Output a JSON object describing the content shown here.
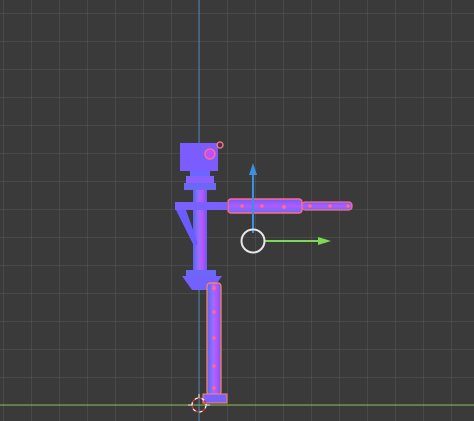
{
  "viewport": {
    "background": "#3a3a3a",
    "grid_color": "#4a4a4a",
    "axis_z_color": "#4a7fb0",
    "axis_x_color": "#8bb84a",
    "model_colors": {
      "primary": "#7b5cff",
      "secondary": "#5a68f0",
      "highlight": "#c04dff",
      "accent": "#ff6a8a",
      "selection": "#ff8a5a"
    },
    "gizmo": {
      "z_arrow_color": "#3d8fe0",
      "x_arrow_color": "#7ed957",
      "ring_color": "#e6e6e6"
    },
    "icons": [
      "move-gizmo-icon",
      "3d-cursor-icon"
    ]
  }
}
